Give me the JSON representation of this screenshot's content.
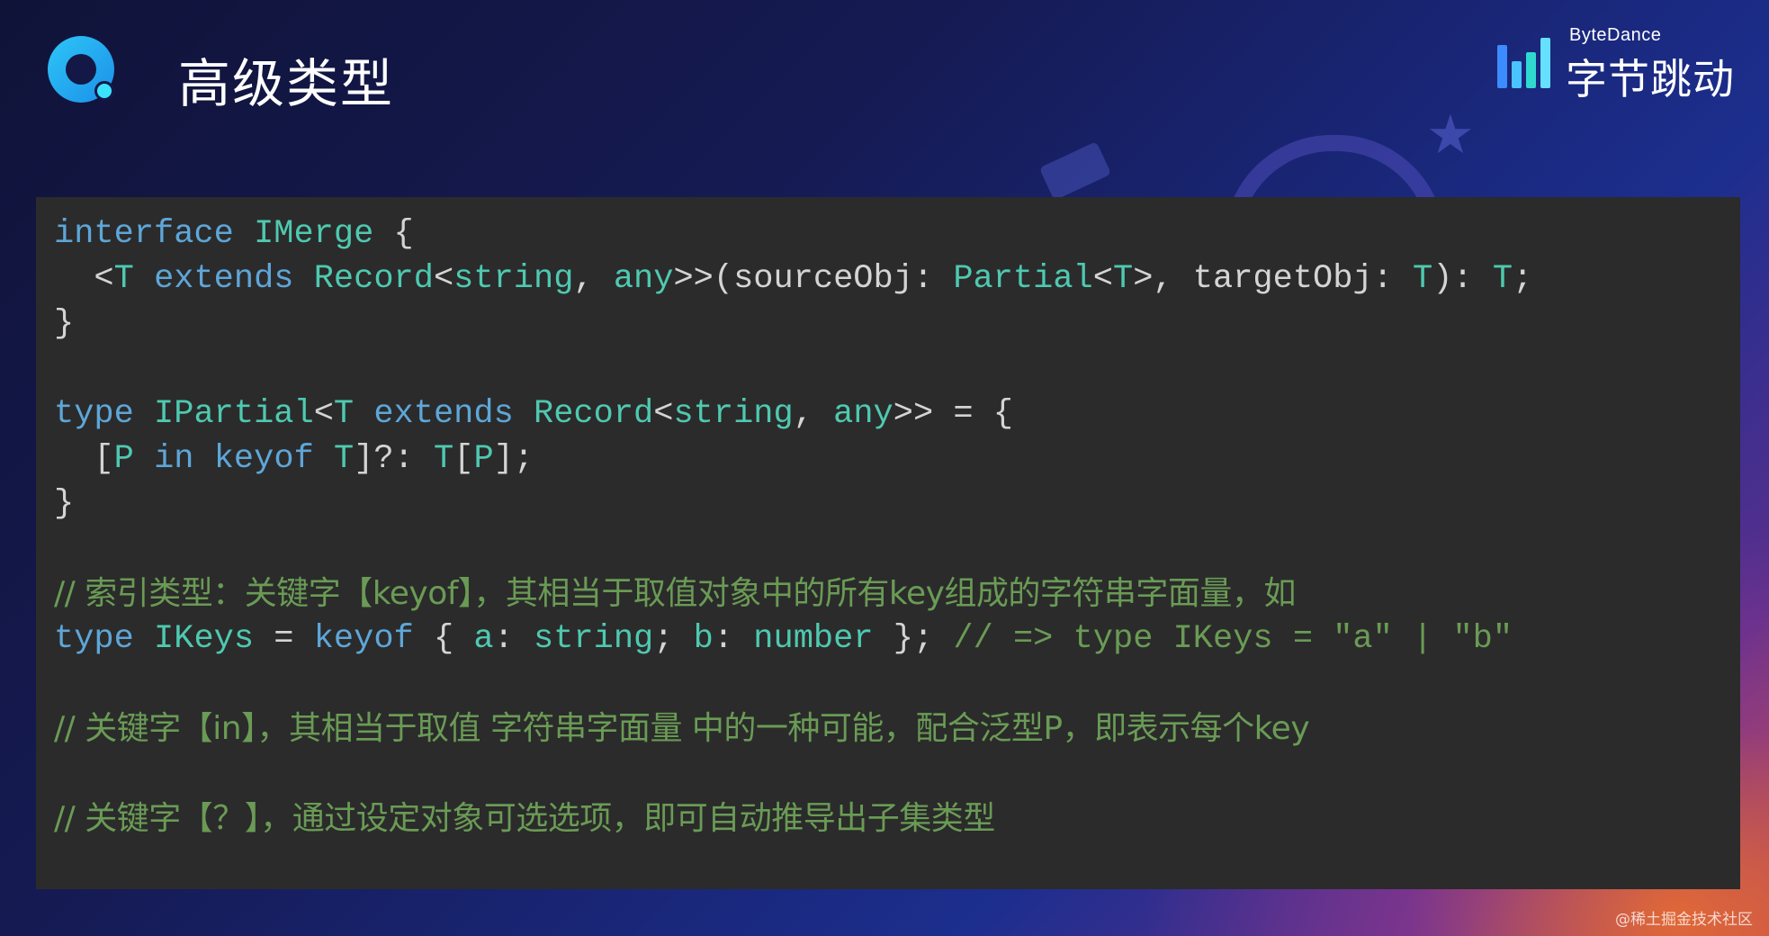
{
  "header": {
    "title": "高级类型",
    "brand_en": "ByteDance",
    "brand_zh": "字节跳动"
  },
  "colors": {
    "keyword": "#5ea6d8",
    "type": "#4ec9b0",
    "plain": "#d4d4d4",
    "comment": "#6a9b55",
    "panel": "#2b2b2b"
  },
  "code": {
    "lines": [
      [
        {
          "t": "interface",
          "c": "keyword"
        },
        {
          "t": " ",
          "c": "plain"
        },
        {
          "t": "IMerge",
          "c": "type"
        },
        {
          "t": " {",
          "c": "plain"
        }
      ],
      [
        {
          "t": "  <",
          "c": "plain"
        },
        {
          "t": "T",
          "c": "type"
        },
        {
          "t": " ",
          "c": "plain"
        },
        {
          "t": "extends",
          "c": "keyword"
        },
        {
          "t": " ",
          "c": "plain"
        },
        {
          "t": "Record",
          "c": "type"
        },
        {
          "t": "<",
          "c": "plain"
        },
        {
          "t": "string",
          "c": "type"
        },
        {
          "t": ", ",
          "c": "plain"
        },
        {
          "t": "any",
          "c": "type"
        },
        {
          "t": ">>(sourceObj: ",
          "c": "plain"
        },
        {
          "t": "Partial",
          "c": "type"
        },
        {
          "t": "<",
          "c": "plain"
        },
        {
          "t": "T",
          "c": "type"
        },
        {
          "t": ">, targetObj: ",
          "c": "plain"
        },
        {
          "t": "T",
          "c": "type"
        },
        {
          "t": "): ",
          "c": "plain"
        },
        {
          "t": "T",
          "c": "type"
        },
        {
          "t": ";",
          "c": "plain"
        }
      ],
      [
        {
          "t": "}",
          "c": "plain"
        }
      ],
      [],
      [
        {
          "t": "type",
          "c": "keyword"
        },
        {
          "t": " ",
          "c": "plain"
        },
        {
          "t": "IPartial",
          "c": "type"
        },
        {
          "t": "<",
          "c": "plain"
        },
        {
          "t": "T",
          "c": "type"
        },
        {
          "t": " ",
          "c": "plain"
        },
        {
          "t": "extends",
          "c": "keyword"
        },
        {
          "t": " ",
          "c": "plain"
        },
        {
          "t": "Record",
          "c": "type"
        },
        {
          "t": "<",
          "c": "plain"
        },
        {
          "t": "string",
          "c": "type"
        },
        {
          "t": ", ",
          "c": "plain"
        },
        {
          "t": "any",
          "c": "type"
        },
        {
          "t": ">> = {",
          "c": "plain"
        }
      ],
      [
        {
          "t": "  [",
          "c": "plain"
        },
        {
          "t": "P",
          "c": "type"
        },
        {
          "t": " ",
          "c": "plain"
        },
        {
          "t": "in",
          "c": "keyword"
        },
        {
          "t": " ",
          "c": "plain"
        },
        {
          "t": "keyof",
          "c": "keyword"
        },
        {
          "t": " ",
          "c": "plain"
        },
        {
          "t": "T",
          "c": "type"
        },
        {
          "t": "]?: ",
          "c": "plain"
        },
        {
          "t": "T",
          "c": "type"
        },
        {
          "t": "[",
          "c": "plain"
        },
        {
          "t": "P",
          "c": "type"
        },
        {
          "t": "];",
          "c": "plain"
        }
      ],
      [
        {
          "t": "}",
          "c": "plain"
        }
      ],
      [],
      [
        {
          "t": "// 索引类型：关键字【keyof】，其相当于取值对象中的所有key组成的字符串字面量，如",
          "c": "comment",
          "zh": true
        }
      ],
      [
        {
          "t": "type",
          "c": "keyword"
        },
        {
          "t": " ",
          "c": "plain"
        },
        {
          "t": "IKeys",
          "c": "type"
        },
        {
          "t": " = ",
          "c": "plain"
        },
        {
          "t": "keyof",
          "c": "keyword"
        },
        {
          "t": " { ",
          "c": "plain"
        },
        {
          "t": "a",
          "c": "type"
        },
        {
          "t": ": ",
          "c": "plain"
        },
        {
          "t": "string",
          "c": "type"
        },
        {
          "t": "; ",
          "c": "plain"
        },
        {
          "t": "b",
          "c": "type"
        },
        {
          "t": ": ",
          "c": "plain"
        },
        {
          "t": "number",
          "c": "type"
        },
        {
          "t": " }; ",
          "c": "plain"
        },
        {
          "t": "// => type IKeys = \"a\" | \"b\"",
          "c": "comment"
        }
      ],
      [],
      [
        {
          "t": "// 关键字【in】，其相当于取值 字符串字面量 中的一种可能，配合泛型P，即表示每个key",
          "c": "comment",
          "zh": true
        }
      ],
      [],
      [
        {
          "t": "// 关键字【？】，通过设定对象可选选项，即可自动推导出子集类型",
          "c": "comment",
          "zh": true
        }
      ]
    ]
  },
  "footer": {
    "credit": "@稀土掘金技术社区"
  }
}
